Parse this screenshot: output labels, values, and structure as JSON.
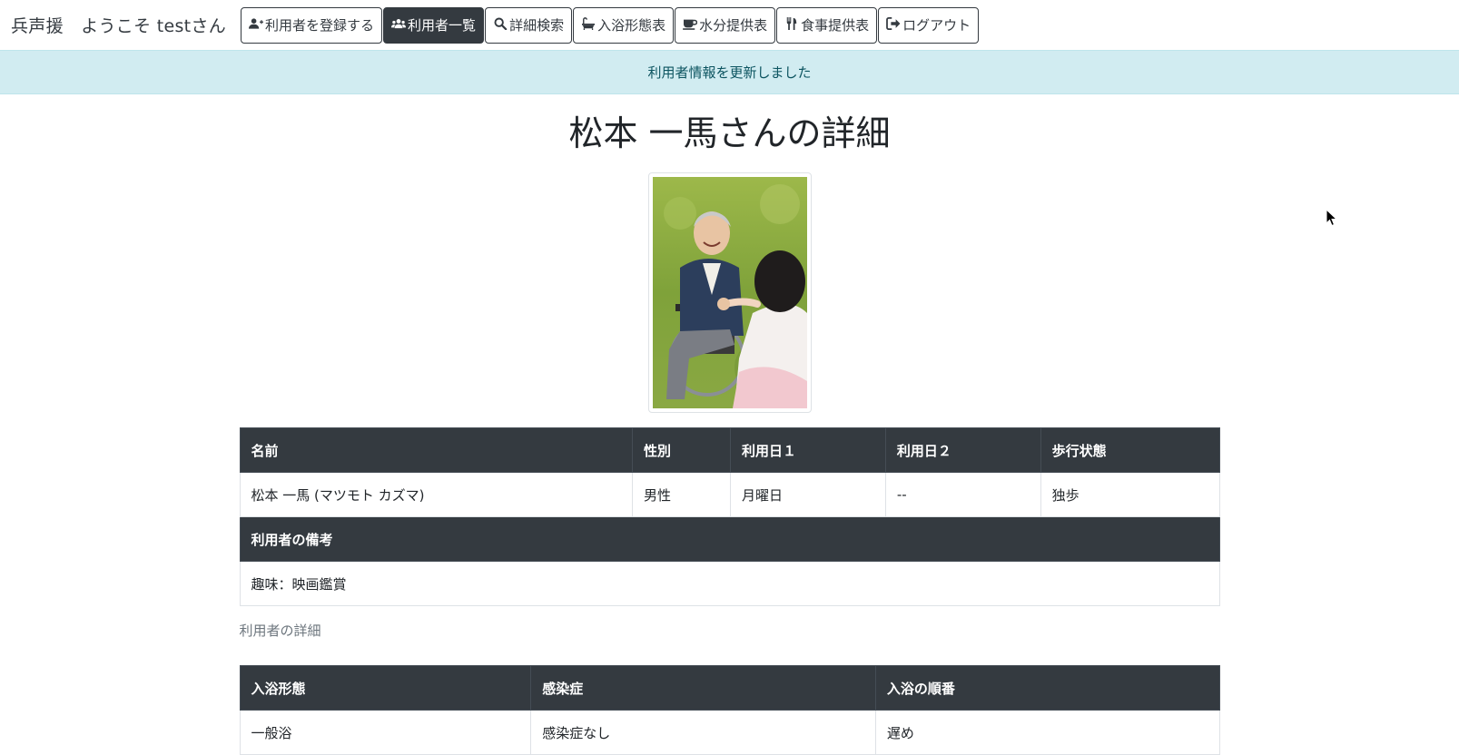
{
  "navbar": {
    "brand": "兵声援　ようこそ testさん",
    "buttons": [
      {
        "label": "利用者を登録する",
        "icon": "user-plus-icon",
        "active": false
      },
      {
        "label": "利用者一覧",
        "icon": "users-icon",
        "active": true
      },
      {
        "label": "詳細検索",
        "icon": "search-icon",
        "active": false
      },
      {
        "label": "入浴形態表",
        "icon": "bath-icon",
        "active": false
      },
      {
        "label": "水分提供表",
        "icon": "coffee-cup-icon",
        "active": false
      },
      {
        "label": "食事提供表",
        "icon": "utensils-icon",
        "active": false
      },
      {
        "label": "ログアウト",
        "icon": "sign-out-icon",
        "active": false
      }
    ]
  },
  "alert": {
    "message": "利用者情報を更新しました"
  },
  "page": {
    "title": "松本 一馬さんの詳細",
    "photo_icon": "user-photo"
  },
  "info_table": {
    "headers": [
      "名前",
      "性別",
      "利用日１",
      "利用日２",
      "歩行状態"
    ],
    "row": [
      "松本 一馬 (マツモト カズマ)",
      "男性",
      "月曜日",
      "--",
      "独歩"
    ],
    "notes_header": "利用者の備考",
    "notes": "趣味：映画鑑賞"
  },
  "subtitle": "利用者の詳細",
  "bath_table": {
    "headers": [
      "入浴形態",
      "感染症",
      "入浴の順番"
    ],
    "row": [
      "一般浴",
      "感染症なし",
      "遅め"
    ]
  },
  "colors": {
    "dark": "#343a40",
    "alert_bg": "#d1ecf1",
    "alert_text": "#0c5460"
  }
}
